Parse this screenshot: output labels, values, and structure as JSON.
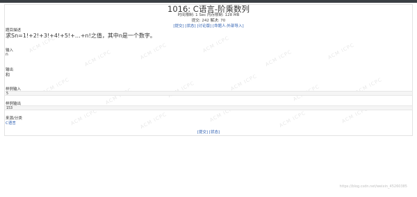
{
  "problem": {
    "title": "1016: C语言-阶乘数列",
    "limits": "时间限制: 1 Sec  内存限制: 128 MB",
    "stats": "提交: 242  解决: 70",
    "links": [
      "[提交]",
      "[状态]",
      "[讨论版]",
      "[命题人:外部导入]"
    ]
  },
  "sections": {
    "desc_label": "题目描述",
    "desc_text": "求Sn=1!+2!+3!+4!+5!+…+n!之值，其中n是一个数字。",
    "input_label": "输入",
    "input_text": "n",
    "output_label": "输出",
    "output_text": "和",
    "sample_input_label": "样例输入",
    "sample_input_value": "5",
    "sample_output_label": "样例输出",
    "sample_output_value": "153",
    "source_label": "来源/分类",
    "source_value": "C语言"
  },
  "bottom_links": [
    "[提交]",
    "[状态]"
  ],
  "watermark_text": "ACM  ICPC",
  "csdn_text": "https://blog.csdn.net/weixin_45260385"
}
